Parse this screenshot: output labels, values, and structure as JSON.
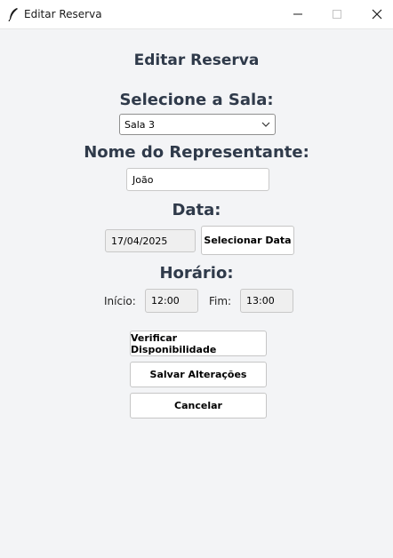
{
  "window": {
    "title": "Editar Reserva",
    "icon": "feather-icon"
  },
  "header": {
    "title": "Editar Reserva"
  },
  "room": {
    "label": "Selecione a Sala:",
    "selected": "Sala 3"
  },
  "representative": {
    "label": "Nome do Representante:",
    "value": "João"
  },
  "date": {
    "label": "Data:",
    "value": "17/04/2025",
    "button": "Selecionar Data"
  },
  "time": {
    "label": "Horário:",
    "start_label": "Início:",
    "start_value": "12:00",
    "end_label": "Fim:",
    "end_value": "13:00"
  },
  "actions": {
    "check": "Verificar Disponibilidade",
    "save": "Salvar Alterações",
    "cancel": "Cancelar"
  }
}
